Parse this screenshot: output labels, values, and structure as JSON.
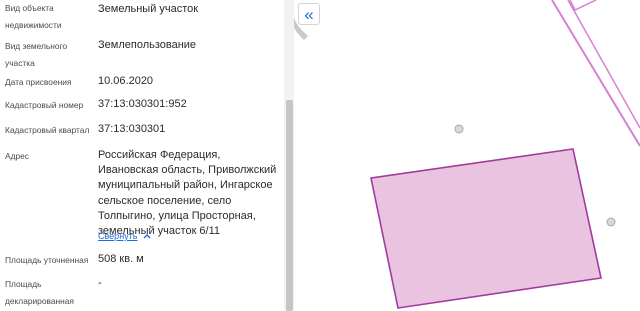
{
  "info": {
    "object_type": {
      "label": "Вид объекта недвижимости",
      "value": "Земельный участок"
    },
    "land_use": {
      "label": "Вид земельного участка",
      "value": "Землепользование"
    },
    "assign_date": {
      "label": "Дата присвоения",
      "value": "10.06.2020"
    },
    "cadastral_number": {
      "label": "Кадастровый номер",
      "value": "37:13:030301:952"
    },
    "cadastral_quarter": {
      "label": "Кадастровый квартал",
      "value": "37:13:030301"
    },
    "address": {
      "label": "Адрес",
      "value": "Российская Федерация, Ивановская область, Приволжский муниципальный район, Ингарское сельское поселение, село Толпыгино, улица Просторная, земельный участок 6/11"
    },
    "collapse_link": "Свернуть",
    "area_specified": {
      "label": "Площадь уточненная",
      "value": "508 кв. м"
    },
    "area_declared": {
      "label": "Площадь декларированная",
      "value": "-"
    }
  },
  "map": {
    "collapse_icon": "double-chevron-left-icon",
    "parcel_fill": "#e9c3df",
    "parcel_stroke": "#a13ba0"
  },
  "colors": {
    "link": "#1a6fdc",
    "label": "#4a4a4a",
    "value": "#2b2b2b"
  }
}
